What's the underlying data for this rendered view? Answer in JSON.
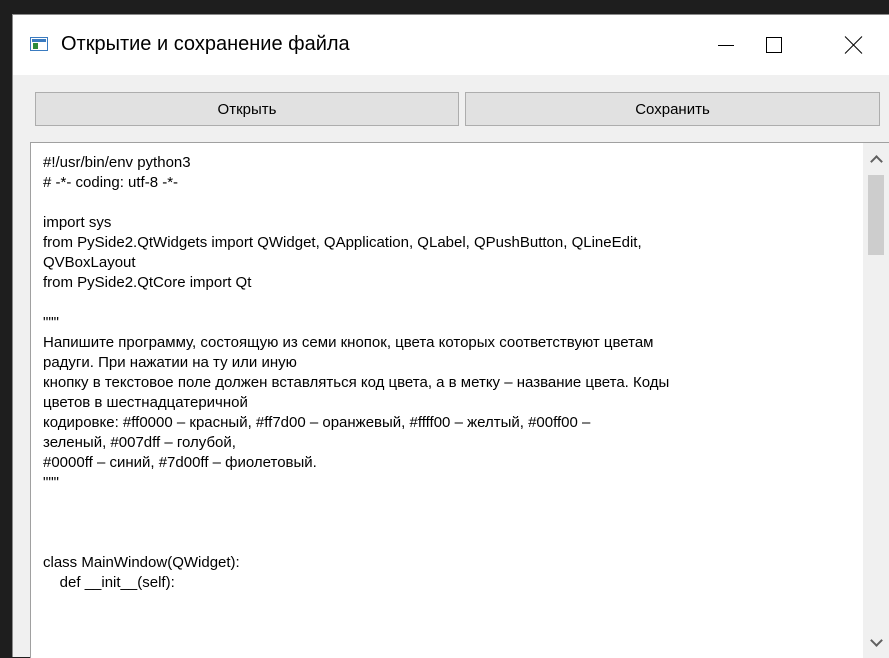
{
  "window": {
    "title": "Открытие и сохранение файла"
  },
  "toolbar": {
    "open_label": "Открыть",
    "save_label": "Сохранить"
  },
  "editor": {
    "content": "#!/usr/bin/env python3\n# -*- coding: utf-8 -*-\n\nimport sys\nfrom PySide2.QtWidgets import QWidget, QApplication, QLabel, QPushButton, QLineEdit,\nQVBoxLayout\nfrom PySide2.QtCore import Qt\n\n\"\"\"\nНапишите программу, состоящую из семи кнопок, цвета которых соответствуют цветам\nрадуги. При нажатии на ту или иную\nкнопку в текстовое поле должен вставляться код цвета, а в метку – название цвета. Коды\nцветов в шестнадцатеричной\nкодировке: #ff0000 – красный, #ff7d00 – оранжевый, #ffff00 – желтый, #00ff00 –\nзеленый, #007dff – голубой,\n#0000ff – синий, #7d00ff – фиолетовый.\n\"\"\"\n\n\n\nclass MainWindow(QWidget):\n    def __init__(self):"
  },
  "icons": {
    "app": "app-window-icon",
    "minimize": "minimize-icon",
    "maximize": "maximize-icon",
    "close": "close-icon",
    "scroll_up": "chevron-up-icon",
    "scroll_down": "chevron-down-icon"
  }
}
